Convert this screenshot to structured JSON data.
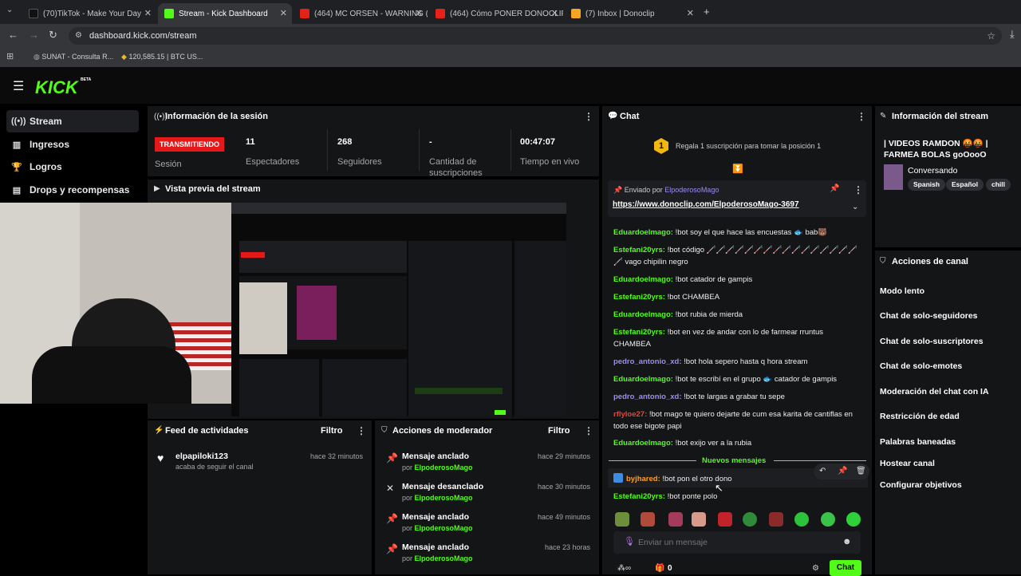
{
  "browser": {
    "tabs": [
      {
        "label": "(70)TikTok - Make Your Day",
        "icon": "tiktok-icon"
      },
      {
        "label": "Stream - Kick Dashboard",
        "icon": "kick-icon",
        "active": true
      },
      {
        "label": "(464) MC ORSEN - WARNING (",
        "icon": "youtube-icon"
      },
      {
        "label": "(464) Cómo PONER DONOCLIP",
        "icon": "youtube-icon"
      },
      {
        "label": "(7) Inbox | Donoclip",
        "icon": "donoclip-icon"
      }
    ],
    "url": "dashboard.kick.com/stream",
    "bookmarks": [
      "SUNAT - Consulta R...",
      "120,585.15 | BTC US..."
    ]
  },
  "kick": {
    "logo": "KICK",
    "beta": "BETA"
  },
  "sidebar": {
    "items": [
      {
        "label": "Stream",
        "icon": "stream-icon",
        "active": true
      },
      {
        "label": "Ingresos",
        "icon": "chart-icon"
      },
      {
        "label": "Logros",
        "icon": "trophy-icon"
      },
      {
        "label": "Drops y recompensas",
        "icon": "gift-icon"
      }
    ]
  },
  "session": {
    "title": "Información de la sesión",
    "status_badge": "TRANSMITIENDO",
    "status_label": "Sesión",
    "stats": [
      {
        "value": "11",
        "label": "Espectadores"
      },
      {
        "value": "268",
        "label": "Seguidores"
      },
      {
        "value": "-",
        "label": "Cantidad de suscripciones"
      },
      {
        "value": "00:47:07",
        "label": "Tiempo en vivo"
      }
    ]
  },
  "preview": {
    "title": "Vista previa del stream"
  },
  "activity": {
    "title": "Feed de actividades",
    "filter": "Filtro",
    "items": [
      {
        "user": "elpapiloki123",
        "text": "acaba de seguir el canal",
        "time": "hace 32 minutos"
      }
    ]
  },
  "mod_actions": {
    "title": "Acciones de moderador",
    "filter": "Filtro",
    "by_prefix": "por",
    "items": [
      {
        "title": "Mensaje anclado",
        "by": "ElpoderosoMago",
        "time": "hace 29 minutos",
        "icon": "pin-icon"
      },
      {
        "title": "Mensaje desanclado",
        "by": "ElpoderosoMago",
        "time": "hace 30 minutos",
        "icon": "unpin-icon"
      },
      {
        "title": "Mensaje anclado",
        "by": "ElpoderosoMago",
        "time": "hace 49 minutos",
        "icon": "pin-icon"
      },
      {
        "title": "Mensaje anclado",
        "by": "ElpoderosoMago",
        "time": "hace 23 horas",
        "icon": "pin-icon"
      }
    ]
  },
  "chat": {
    "title": "Chat",
    "gift_banner": "Regala 1 suscripción para tomar la posición 1",
    "gift_rank": "1",
    "pinned_by_prefix": "Enviado por",
    "pinned_by": "ElpoderosoMago",
    "pinned_link": "https://www.donoclip.com/ElpoderosoMago-3697",
    "new_messages": "Nuevos mensajes",
    "messages": [
      {
        "user": "Eduardoelmago:",
        "text": " !bot soy el que hace las encuestas 🐟 bab🐻"
      },
      {
        "user": "Estefani20yrs:",
        "text": " !bot código 🦯🦯🦯🦯🦯🦯🦯🦯🦯🦯🦯🦯🦯🦯🦯🦯🦯 vago chipilin negro"
      },
      {
        "user": "Eduardoelmago:",
        "text": " !bot catador de gampis"
      },
      {
        "user": "Estefani20yrs:",
        "text": " !bot CHAMBEA"
      },
      {
        "user": "Eduardoelmago:",
        "text": " !bot rubia de mierda"
      },
      {
        "user": "Estefani20yrs:",
        "text": " !bot en vez de andar con lo de farmear rruntus CHAMBEA"
      },
      {
        "user": "pedro_antonio_xd:",
        "text": " !bot hola sepero hasta q hora stream"
      },
      {
        "user": "Eduardoelmago:",
        "text": " !bot te escribí en el grupo 🐟 catador de gampis"
      },
      {
        "user": "pedro_antonio_xd:",
        "text": " !bot te largas a grabar tu sepe"
      },
      {
        "user": "rflyloe27:",
        "text": " !bot mago te quiero dejarte de cum esa karita de cantiflas en todo ese bigote papi"
      },
      {
        "user": "Eduardoelmago:",
        "text": " !bot exijo ver a la rubia"
      },
      {
        "user": "byjhared:",
        "text": " !bot pon el otro dono"
      },
      {
        "user": "Estefani20yrs:",
        "text": " !bot ponte polo"
      }
    ],
    "input_placeholder": "Enviar un mensaje",
    "points": "0",
    "send_label": "Chat"
  },
  "stream_info": {
    "title": "Información del stream",
    "stream_title": "| VIDEOS RAMDON 🤬🤬 | FARMEA BOLAS goOooO",
    "category": "Conversando",
    "tags": [
      "Spanish",
      "Español",
      "chill"
    ]
  },
  "channel_actions": {
    "title": "Acciones de canal",
    "items": [
      "Modo lento",
      "Chat de solo-seguidores",
      "Chat de solo-suscriptores",
      "Chat de solo-emotes",
      "Moderación del chat con IA",
      "Restricción de edad",
      "Palabras baneadas",
      "Hostear canal",
      "Configurar objetivos"
    ]
  },
  "colors": {
    "accent": "#53fc18",
    "live": "#e51919",
    "panel": "#141517",
    "background": "#000000"
  }
}
